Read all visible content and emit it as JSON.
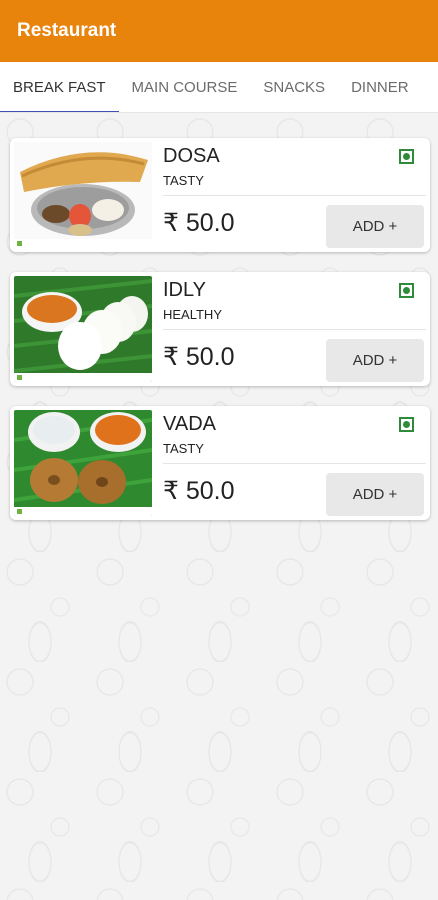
{
  "app": {
    "title": "Restaurant",
    "accent": "#e8830c"
  },
  "tabs": [
    {
      "label": "BREAK FAST",
      "active": true
    },
    {
      "label": "MAIN COURSE"
    },
    {
      "label": "SNACKS"
    },
    {
      "label": "DINNER"
    }
  ],
  "items": [
    {
      "name": "DOSA",
      "description": "TASTY",
      "price": "₹ 50.0",
      "button": "ADD +",
      "icon": "veg-icon"
    },
    {
      "name": "IDLY",
      "description": "HEALTHY",
      "price": "₹ 50.0",
      "button": "ADD +",
      "icon": "veg-icon"
    },
    {
      "name": "VADA",
      "description": "TASTY",
      "price": "₹ 50.0",
      "button": "ADD +",
      "icon": "veg-icon"
    }
  ]
}
